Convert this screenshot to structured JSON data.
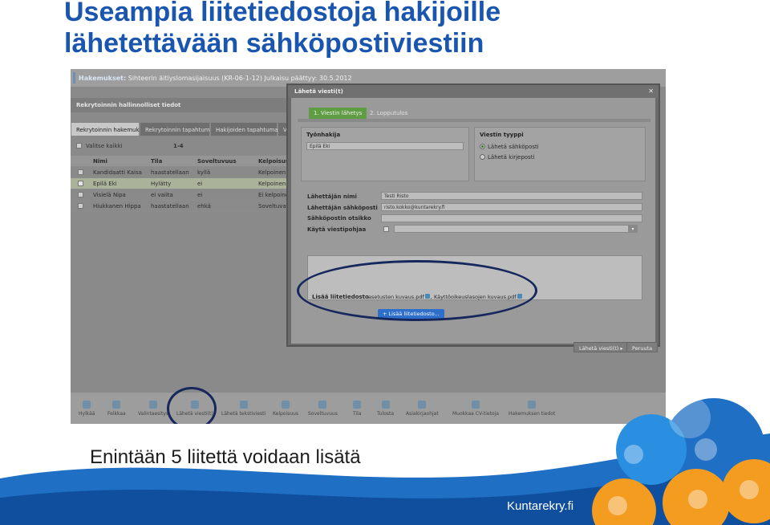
{
  "slide": {
    "title_line1": "Useampia liitetiedostoja hakijoille",
    "title_line2": "lähetettävään sähköpostiviestiin",
    "caption": "Enintään 5 liitettä voidaan lisätä",
    "brand": "Kuntarekry.fi",
    "colors": {
      "title": "#1a56b0",
      "wave": "#1f6fc4",
      "accent": "#f39c1f"
    }
  },
  "app": {
    "breadcrumb_label": "Hakemukset:",
    "breadcrumb_text": "Sihteerin äitiyslomasijaisuus (KR-06-1-12) Julkaisu päättyy: 30.5.2012",
    "section_title": "Rekrytoinnin hallinnolliset tiedot",
    "tabs": [
      "Rekrytoinnin hakemukset",
      "Rekrytoinnin tapahtumaloki",
      "Hakijoiden tapahtumaloki",
      "Vi"
    ],
    "select_all": "Valitse kaikki",
    "count": "1-4",
    "columns": [
      "Nimi",
      "Tila",
      "Soveltuvuus",
      "Kelpoisuus"
    ],
    "rows": [
      [
        "Kandidaatti Kaisa",
        "haastatellaan",
        "kyllä",
        "Kelpoinen"
      ],
      [
        "Epilä Eki",
        "Hylätty",
        "ei",
        "Kelpoinen"
      ],
      [
        "Visielä Nipa",
        "ei vaiita",
        "ei",
        "Ei kelpoinen"
      ],
      [
        "Hiukkanen Hippa",
        "haastatellaan",
        "ehkä",
        "Soveltuva"
      ]
    ],
    "toolbar": [
      "Hylkää",
      "Felkkaa",
      "Valintaesitys",
      "Lähetä viesti(t)",
      "Lähetä tekstiviesti",
      "Kelpoisuus",
      "Soveltuvuus",
      "Tila",
      "Tulosta",
      "Asiakirjaohjat",
      "Muokkaa CV-tietoja",
      "Hakemuksen tiedot"
    ]
  },
  "modal": {
    "title": "Lähetä viesti(t)",
    "close": "✕",
    "step1": "1. Viestin lähetys",
    "step2": "2. Lopputulos",
    "applicant_heading": "Työnhakija",
    "applicant_value": "Epilä Eki",
    "type_heading": "Viestin tyyppi",
    "type_options": [
      "Lähetä sähköposti",
      "Lähetä kirjeposti"
    ],
    "sender_name_label": "Lähettäjän nimi",
    "sender_name_value": "Testi Risto",
    "sender_email_label": "Lähettäjän sähköposti",
    "sender_email_value": "risto.kokko@kuntarekry.fi",
    "subject_label": "Sähköpostin otsikko",
    "subject_value": "",
    "template_label": "Käytä viestipohjaa",
    "attach_label": "Lisää liitetiedosto",
    "attachments": [
      "asetusten kuvaus.pdf",
      "Käyttöoikeuslasojen kuvaus.pdf"
    ],
    "add_attachment": "Lisää liitetiedosto...",
    "send_button": "Lähetä viesti(t)",
    "cancel_button": "Peruuta"
  }
}
